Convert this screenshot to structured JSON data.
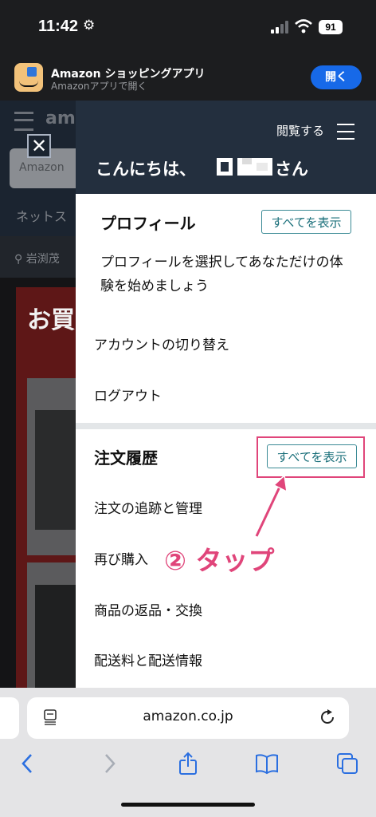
{
  "status_bar": {
    "time": "11:42",
    "battery": "91"
  },
  "smart_banner": {
    "app_title": "Amazon ショッピングアプリ",
    "app_subtitle": "Amazonアプリで開く",
    "open_button": "開く"
  },
  "background_page": {
    "logo_fragment": "am",
    "search_placeholder_fragment": "Amazon",
    "nav_fragment": "ネットス",
    "location_fragment": "岩渕茂",
    "banner_title_fragment": "お買"
  },
  "drawer": {
    "browse_label": "閲覧する",
    "greeting": "こんにちは、",
    "greeting_suffix": "さん",
    "profile": {
      "title": "プロフィール",
      "see_all": "すべてを表示",
      "description": "プロフィールを選択してあなただけの体験を始めましょう"
    },
    "account_items": [
      "アカウントの切り替え",
      "ログアウト"
    ],
    "orders": {
      "title": "注文履歴",
      "see_all": "すべてを表示",
      "items": [
        "注文の追跡と管理",
        "再び購入",
        "商品の返品・交換",
        "配送料と配送情報"
      ]
    }
  },
  "annotation": {
    "text": "② タップ",
    "color": "#e0457a"
  },
  "browser": {
    "url": "amazon.co.jp"
  }
}
